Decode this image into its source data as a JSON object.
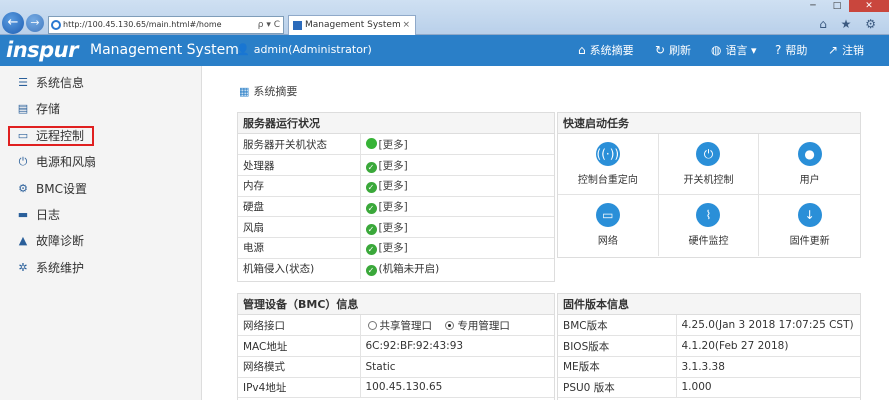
{
  "browser": {
    "url": "http://100.45.130.65/main.html#/home",
    "tab_title": "Management System",
    "search_icons": "ρ ▾ C",
    "tab_close": "×",
    "win_min": "─",
    "win_max": "□",
    "win_close": "✕",
    "right_icons": "⌂ ★ ⚙"
  },
  "header": {
    "logo": "inspur",
    "title": "Management System",
    "user": "admin(Administrator)",
    "nav": [
      {
        "label": "系统摘要",
        "icon": "home-icon"
      },
      {
        "label": "刷新",
        "icon": "refresh-icon"
      },
      {
        "label": "语言",
        "icon": "globe-icon",
        "caret": "▾"
      },
      {
        "label": "帮助",
        "icon": "help-icon"
      },
      {
        "label": "注销",
        "icon": "logout-icon"
      }
    ]
  },
  "sidebar": {
    "items": [
      {
        "label": "系统信息",
        "icon": "list-icon"
      },
      {
        "label": "存储",
        "icon": "storage-icon"
      },
      {
        "label": "远程控制",
        "icon": "monitor-icon"
      },
      {
        "label": "电源和风扇",
        "icon": "power-icon"
      },
      {
        "label": "BMC设置",
        "icon": "gear-icon"
      },
      {
        "label": "日志",
        "icon": "log-icon"
      },
      {
        "label": "故障诊断",
        "icon": "warning-icon"
      },
      {
        "label": "系统维护",
        "icon": "maintenance-icon"
      }
    ],
    "active_index": 2
  },
  "main": {
    "page_title": "系统摘要",
    "server_status": {
      "title": "服务器运行状况",
      "rows": [
        {
          "key": "服务器开关机状态",
          "value": "[更多]",
          "status": "on"
        },
        {
          "key": "处理器",
          "value": "[更多]",
          "status": "ok"
        },
        {
          "key": "内存",
          "value": "[更多]",
          "status": "ok"
        },
        {
          "key": "硬盘",
          "value": "[更多]",
          "status": "ok"
        },
        {
          "key": "风扇",
          "value": "[更多]",
          "status": "ok"
        },
        {
          "key": "电源",
          "value": "[更多]",
          "status": "ok"
        },
        {
          "key": "机箱侵入(状态)",
          "value": "(机箱未开启)",
          "status": "ok"
        }
      ]
    },
    "quick_tasks": {
      "title": "快速启动任务",
      "items": [
        {
          "label": "控制台重定向",
          "icon": "console-redirect-icon"
        },
        {
          "label": "开关机控制",
          "icon": "power-control-icon"
        },
        {
          "label": "用户",
          "icon": "user-icon"
        },
        {
          "label": "网络",
          "icon": "network-icon"
        },
        {
          "label": "硬件监控",
          "icon": "hardware-monitor-icon"
        },
        {
          "label": "固件更新",
          "icon": "firmware-update-icon"
        }
      ]
    },
    "bmc_info": {
      "title": "管理设备（BMC）信息",
      "network_port_label": "网络接口",
      "port_options": [
        {
          "label": "共享管理口",
          "selected": false
        },
        {
          "label": "专用管理口",
          "selected": true
        }
      ],
      "rows": [
        {
          "key": "MAC地址",
          "value": "6C:92:BF:92:43:93"
        },
        {
          "key": "网络模式",
          "value": "Static"
        },
        {
          "key": "IPv4地址",
          "value": "100.45.130.65"
        }
      ]
    },
    "firmware": {
      "title": "固件版本信息",
      "rows": [
        {
          "key": "BMC版本",
          "value": "4.25.0(Jan 3 2018 17:07:25 CST)"
        },
        {
          "key": "BIOS版本",
          "value": "4.1.20(Feb 27 2018)"
        },
        {
          "key": "ME版本",
          "value": "3.1.3.38"
        },
        {
          "key": "PSU0 版本",
          "value": "1.000"
        }
      ]
    }
  },
  "colors": {
    "header_bg": "#2a7fc8",
    "sidebar_bg": "#f4f4f4",
    "ok_green": "#3aa83a",
    "quick_icon_blue": "#2a8fd8",
    "active_outline": "#e02020"
  }
}
